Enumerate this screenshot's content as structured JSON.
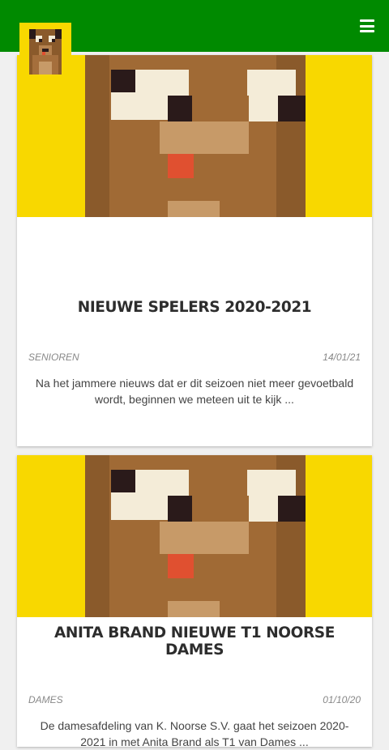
{
  "header": {
    "menu_icon": "bars-icon",
    "logo_icon": "pixel-dog-logo",
    "brand_color": "#008a00"
  },
  "articles": [
    {
      "title": "NIEUWE SPELERS 2020-2021",
      "category": "SENIOREN",
      "date": "14/01/21",
      "excerpt": "Na het jammere nieuws dat er dit seizoen niet meer gevoetbald wordt, beginnen we meteen uit te kijk ..."
    },
    {
      "title": "ANITA BRAND NIEUWE T1 NOORSE DAMES",
      "category": "DAMES",
      "date": "01/10/20",
      "excerpt": "De damesafdeling van K. Noorse S.V. gaat het seizoen 2020-2021 in met Anita Brand als T1 van Dames ..."
    }
  ]
}
